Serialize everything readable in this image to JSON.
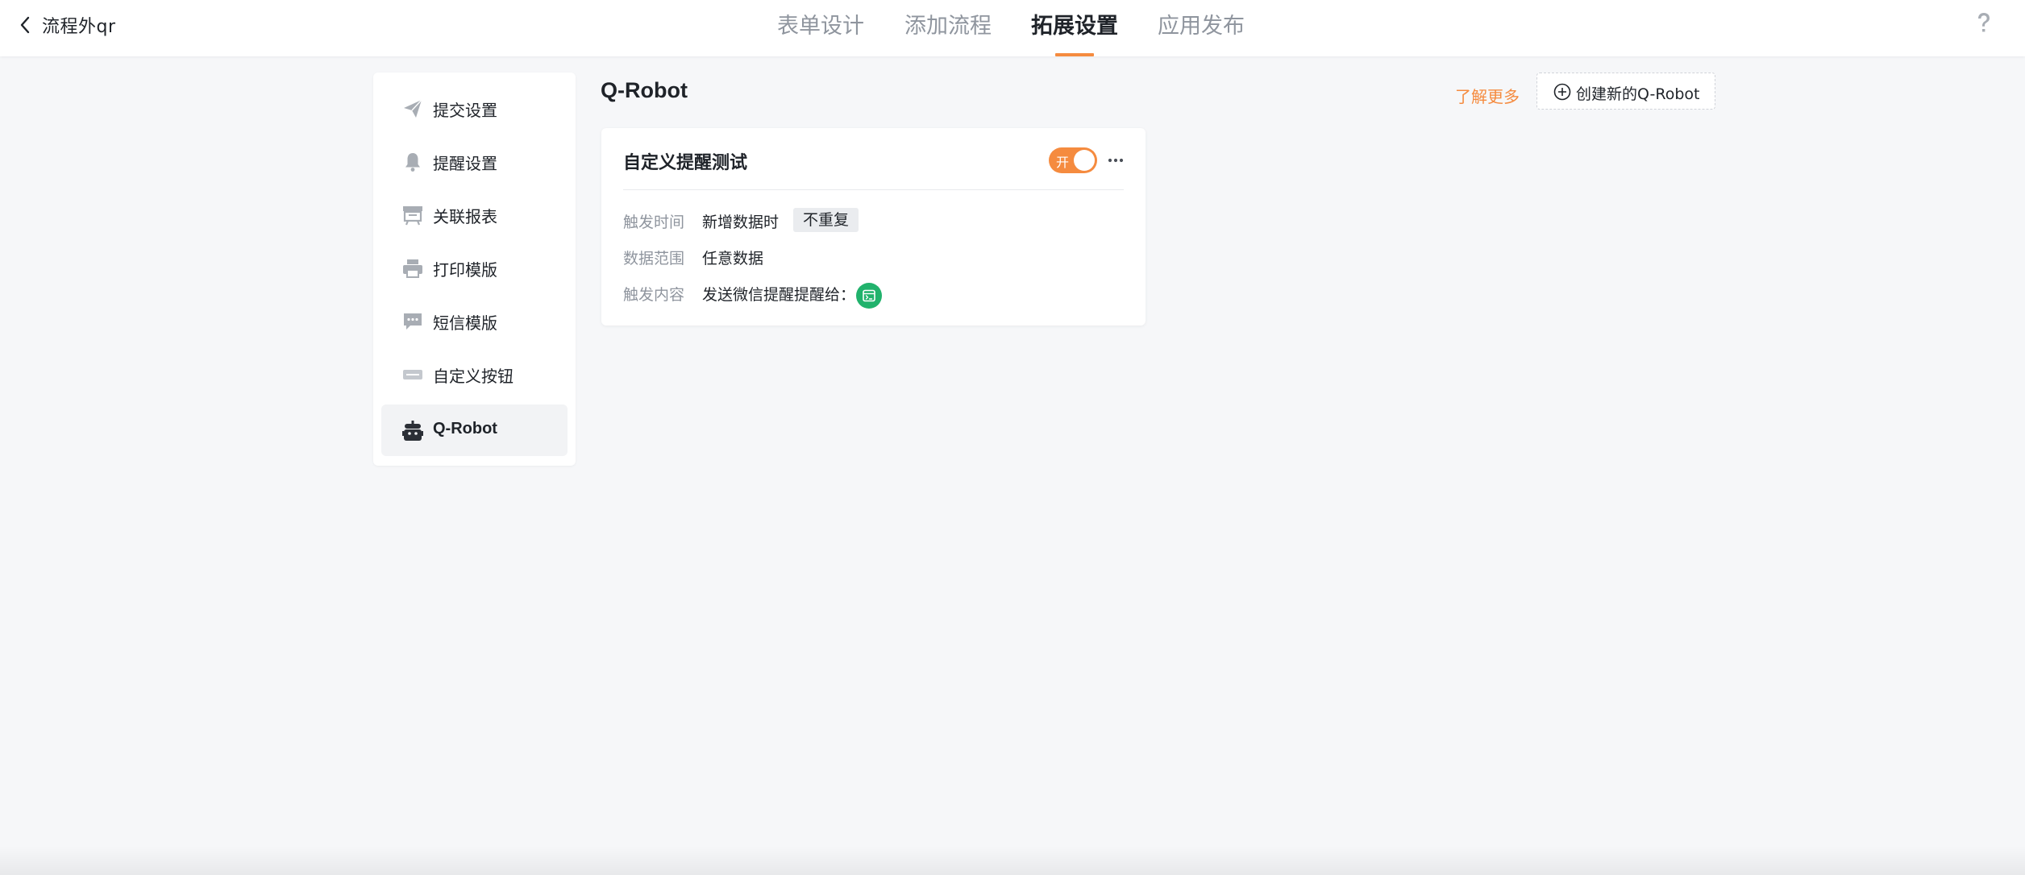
{
  "header": {
    "back_icon": "chevron-left-icon",
    "app_title": "流程外qr",
    "tabs": [
      {
        "label": "表单设计",
        "active": false
      },
      {
        "label": "添加流程",
        "active": false
      },
      {
        "label": "拓展设置",
        "active": true
      },
      {
        "label": "应用发布",
        "active": false
      }
    ],
    "help_icon": "question-mark-icon",
    "accent_color": "#f58b3f"
  },
  "sidebar": {
    "items": [
      {
        "label": "提交设置",
        "icon": "paper-plane-icon",
        "active": false
      },
      {
        "label": "提醒设置",
        "icon": "bell-icon",
        "active": false
      },
      {
        "label": "关联报表",
        "icon": "report-board-icon",
        "active": false
      },
      {
        "label": "打印模版",
        "icon": "printer-icon",
        "active": false
      },
      {
        "label": "短信模版",
        "icon": "chat-bubble-icon",
        "active": false
      },
      {
        "label": "自定义按钮",
        "icon": "custom-button-icon",
        "active": false
      },
      {
        "label": "Q-Robot",
        "icon": "robot-icon",
        "active": true
      }
    ]
  },
  "main": {
    "title": "Q-Robot",
    "learn_more": "了解更多",
    "create_button": "创建新的Q-Robot",
    "card": {
      "title": "自定义提醒测试",
      "toggle": {
        "label": "开",
        "on": true
      },
      "rows": [
        {
          "label": "触发时间",
          "value": "新增数据时",
          "tag": "不重复"
        },
        {
          "label": "数据范围",
          "value": "任意数据"
        },
        {
          "label": "触发内容",
          "value": "发送微信提醒提醒给："
        }
      ],
      "recipient_icon": "wechat-avatar-icon"
    }
  }
}
